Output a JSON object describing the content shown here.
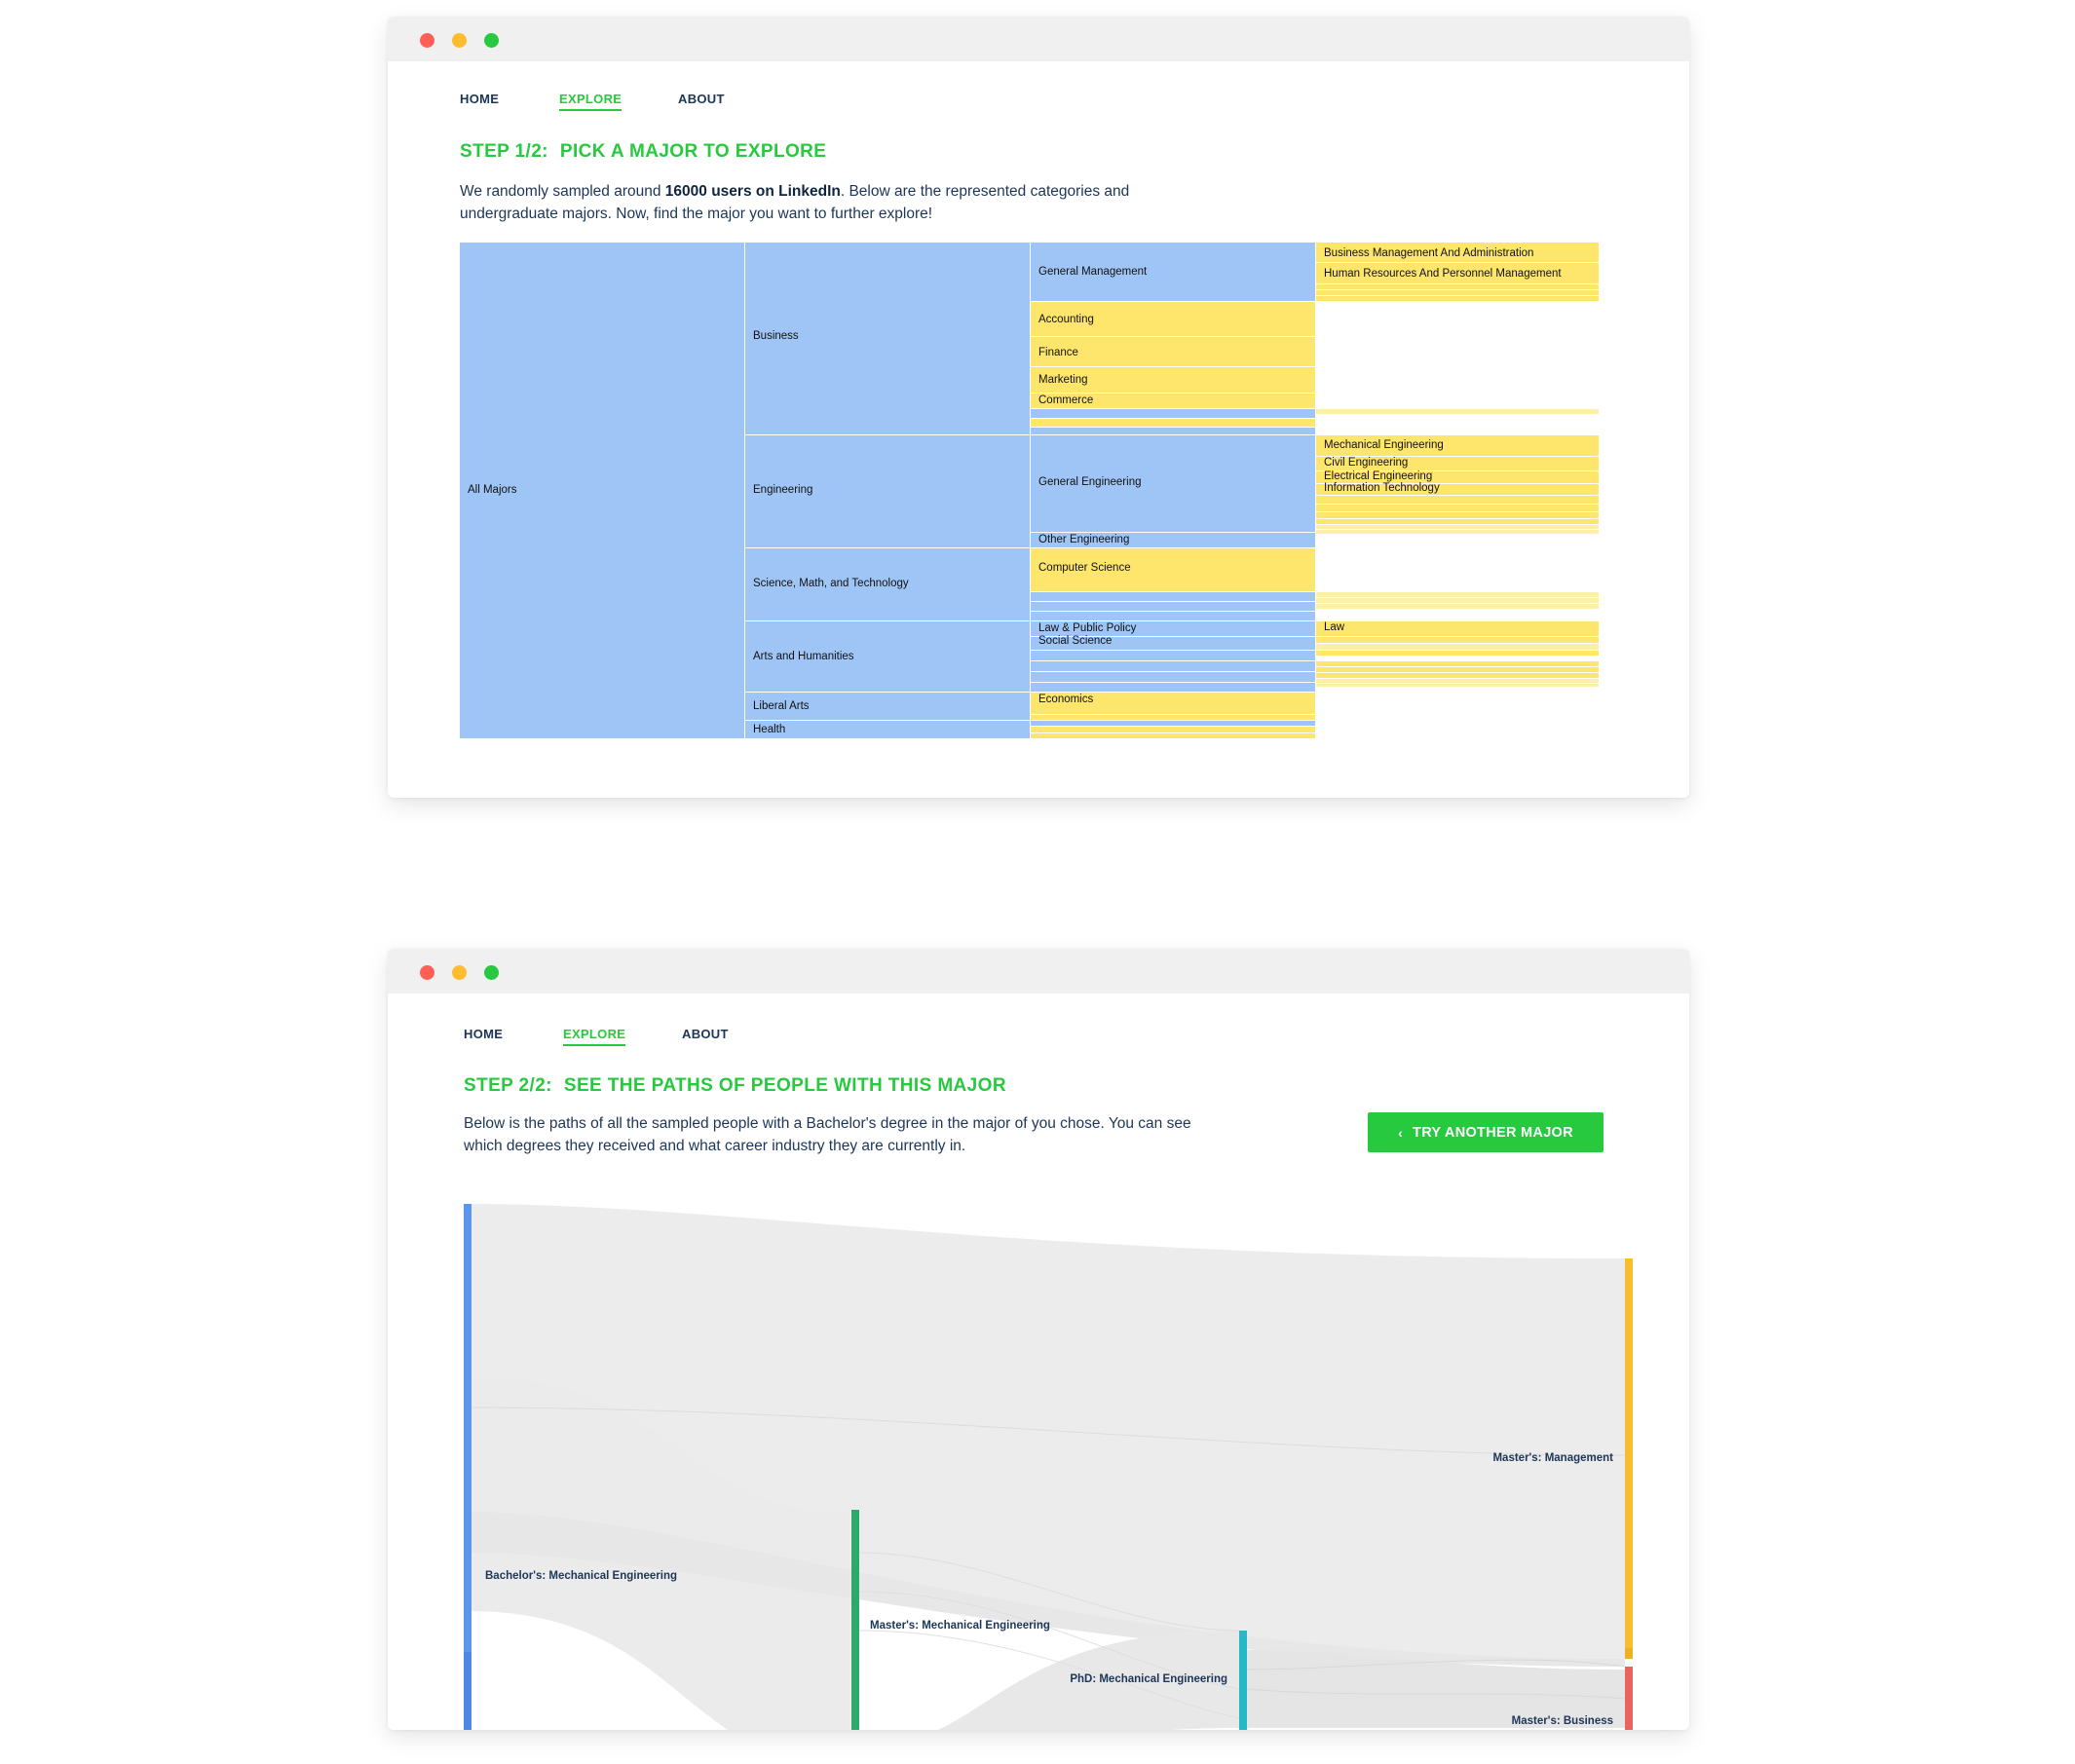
{
  "screen1": {
    "nav": [
      {
        "label": "HOME",
        "active": false
      },
      {
        "label": "EXPLORE",
        "active": true
      },
      {
        "label": "ABOUT",
        "active": false
      }
    ],
    "step": {
      "prefix": "STEP 1/2:",
      "title": "PICK A MAJOR TO EXPLORE"
    },
    "intro": {
      "before": "We randomly sampled around ",
      "bold": "16000 users on LinkedIn",
      "after": ". Below are the represented categories and undergraduate majors. Now, find the major you want to further explore!"
    },
    "icicle": {
      "root": "All Majors",
      "categories": [
        "Business",
        "Engineering",
        "Science, Math, and Technology",
        "Arts and Humanities",
        "Liberal Arts",
        "Health"
      ],
      "subcategories": [
        "General Management",
        "Accounting",
        "Finance",
        "Marketing",
        "Commerce",
        "General Engineering",
        "Other Engineering",
        "Computer Science",
        "Law & Public Policy",
        "Social Science",
        "Economics"
      ],
      "majors": [
        "Business Management And Administration",
        "Human Resources And Personnel Management",
        "Mechanical Engineering",
        "Civil Engineering",
        "Electrical Engineering",
        "Information Technology",
        "Law"
      ],
      "colors": {
        "category": "#9ec5f5",
        "leaf": "#fde66b"
      }
    }
  },
  "screen2": {
    "nav": [
      {
        "label": "HOME",
        "active": false
      },
      {
        "label": "EXPLORE",
        "active": true
      },
      {
        "label": "ABOUT",
        "active": false
      }
    ],
    "step": {
      "prefix": "STEP 2/2:",
      "title": "SEE THE PATHS OF PEOPLE WITH THIS MAJOR"
    },
    "intro": "Below is the paths of all the sampled people with a Bachelor's degree in the major of you chose. You can see which degrees they received and what career industry they are currently in.",
    "button": {
      "label": "TRY ANOTHER MAJOR",
      "icon": "chevron-left-icon"
    },
    "sankey": {
      "nodes": [
        {
          "name": "Bachelor's: Mechanical Engineering",
          "color": "#5b95ec"
        },
        {
          "name": "Master's: Mechanical Engineering",
          "color": "#2bab6b"
        },
        {
          "name": "PhD: Mechanical Engineering",
          "color": "#25b9c8"
        },
        {
          "name": "Master's: Management",
          "color": "#f8bd2d"
        },
        {
          "name": "Master's: Business",
          "color": "#e9635f"
        }
      ],
      "link_color": "#e3e3e3"
    }
  },
  "colors": {
    "accent": "#27c93f",
    "text": "#1d3557"
  }
}
